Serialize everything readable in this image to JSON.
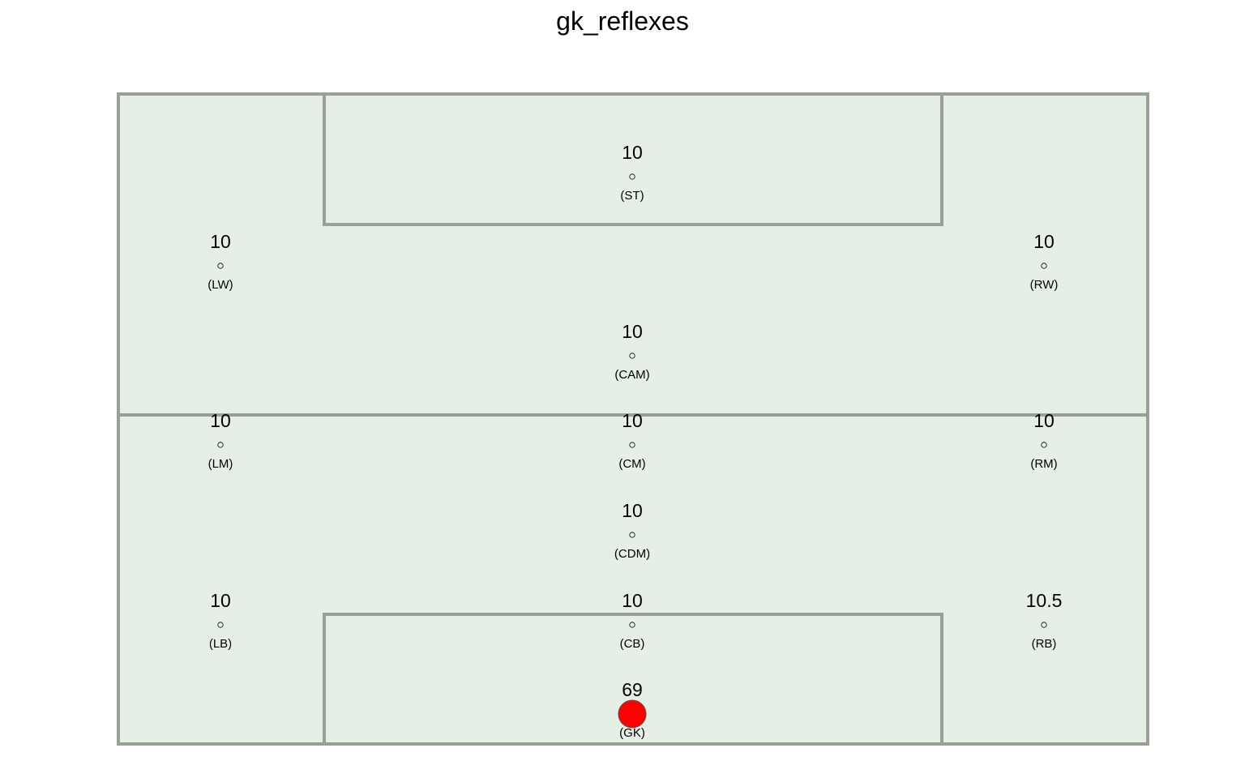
{
  "chart_data": {
    "type": "scatter",
    "title": "gk_reflexes",
    "colors": {
      "pitch_fill": "#e5efe5",
      "pitch_line": "#98a098",
      "marker_default": "#e5efe5",
      "marker_highlight": "#ff0000",
      "marker_stroke": "#000000"
    },
    "positions": [
      {
        "code": "ST",
        "label": "(ST)",
        "value": 10,
        "value_label": "10"
      },
      {
        "code": "LW",
        "label": "(LW)",
        "value": 10,
        "value_label": "10"
      },
      {
        "code": "RW",
        "label": "(RW)",
        "value": 10,
        "value_label": "10"
      },
      {
        "code": "CAM",
        "label": "(CAM)",
        "value": 10,
        "value_label": "10"
      },
      {
        "code": "LM",
        "label": "(LM)",
        "value": 10,
        "value_label": "10"
      },
      {
        "code": "CM",
        "label": "(CM)",
        "value": 10,
        "value_label": "10"
      },
      {
        "code": "RM",
        "label": "(RM)",
        "value": 10,
        "value_label": "10"
      },
      {
        "code": "CDM",
        "label": "(CDM)",
        "value": 10,
        "value_label": "10"
      },
      {
        "code": "LB",
        "label": "(LB)",
        "value": 10,
        "value_label": "10"
      },
      {
        "code": "CB",
        "label": "(CB)",
        "value": 10,
        "value_label": "10"
      },
      {
        "code": "RB",
        "label": "(RB)",
        "value": 10.5,
        "value_label": "10.5"
      },
      {
        "code": "GK",
        "label": "(GK)",
        "value": 69,
        "value_label": "69"
      }
    ]
  }
}
